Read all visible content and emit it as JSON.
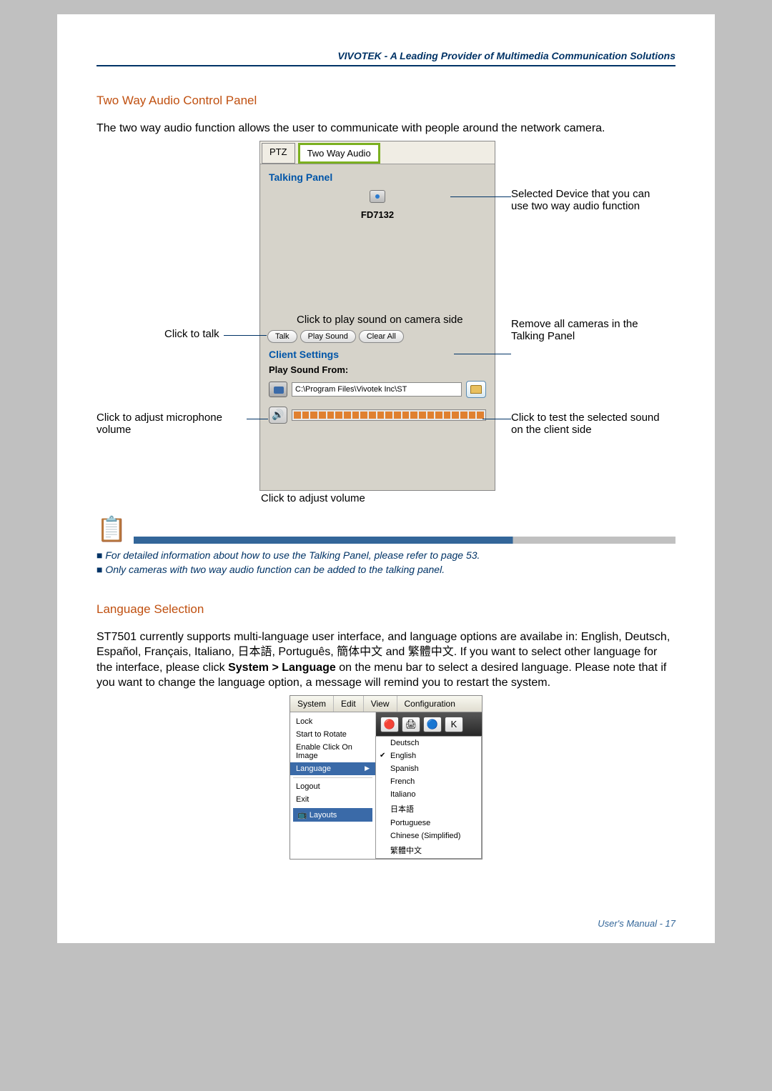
{
  "header": "VIVOTEK - A Leading Provider of Multimedia Communication Solutions",
  "section1": {
    "title": "Two Way Audio Control Panel",
    "para": "The two way audio function allows the user to communicate with people around the network camera."
  },
  "panel": {
    "tab_ptz": "PTZ",
    "tab_twa": "Two Way Audio",
    "talking_panel": "Talking Panel",
    "device": "FD7132",
    "btn_talk": "Talk",
    "btn_play": "Play Sound",
    "btn_clear": "Clear All",
    "client_settings": "Client Settings",
    "psf": "Play Sound From:",
    "path": "C:\\Program Files\\Vivotek Inc\\ST"
  },
  "callouts": {
    "selected_device": "Selected Device that you can use two way audio function",
    "play_sound": "Click to play sound on camera side",
    "remove_all": "Remove all cameras in the Talking Panel",
    "click_talk": "Click to talk",
    "adj_mic": "Click to adjust microphone volume",
    "test_sound": "Click to test the selected sound on the client side",
    "adj_vol": "Click to adjust volume"
  },
  "notes": {
    "n1": "For detailed information about how to use the Talking Panel, please refer to page 53.",
    "n2": "Only cameras with two way audio function can be added to the talking panel."
  },
  "section2": {
    "title": "Language Selection",
    "para1": "ST7501 currently supports multi-language user interface, and language options are availabe in: English, Deutsch, Español, Français, Italiano, 日本語, Português, 簡体中文 and 繁體中文. If you want to select other language for the interface, please click ",
    "bold": "System > Language",
    "para2": " on the menu bar to select a desired language. Please note that if you want to change the language option, a message will remind you to restart the system."
  },
  "menu": {
    "system": "System",
    "edit": "Edit",
    "view": "View",
    "config": "Configuration",
    "lock": "Lock",
    "rotate": "Start to Rotate",
    "enable": "Enable Click On Image",
    "language": "Language",
    "logout": "Logout",
    "exit": "Exit",
    "layouts": "Layouts",
    "langs": {
      "de": "Deutsch",
      "en": "English",
      "es": "Spanish",
      "fr": "French",
      "it": "Italiano",
      "jp": "日本語",
      "pt": "Portuguese",
      "zhs": "Chinese (Simplified)",
      "zht": "繁體中文"
    }
  },
  "footer": "User's Manual - 17"
}
